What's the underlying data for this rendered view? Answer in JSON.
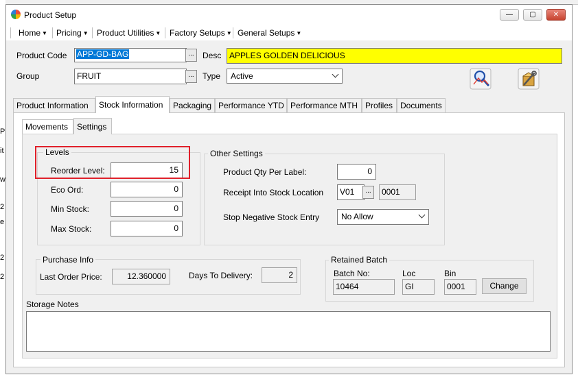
{
  "window": {
    "title": "Product Setup"
  },
  "menu": [
    {
      "label": "Home"
    },
    {
      "label": "Pricing"
    },
    {
      "label": "Product Utilities"
    },
    {
      "label": "Factory Setups"
    },
    {
      "label": "General Setups"
    }
  ],
  "header": {
    "product_code_label": "Product Code",
    "product_code_value": "APP-GD-BAG",
    "desc_label": "Desc",
    "desc_value": "APPLES GOLDEN DELICIOUS",
    "group_label": "Group",
    "group_value": "FRUIT",
    "type_label": "Type",
    "type_value": "Active",
    "ellipsis": "..."
  },
  "tabs": [
    "Product Information",
    "Stock Information",
    "Packaging",
    "Performance YTD",
    "Performance MTH",
    "Profiles",
    "Documents"
  ],
  "subtabs": [
    "Movements",
    "Settings"
  ],
  "levels": {
    "title": "Levels",
    "reorder_label": "Reorder Level:",
    "reorder_value": "15",
    "eco_label": "Eco Ord:",
    "eco_value": "0",
    "min_label": "Min Stock:",
    "min_value": "0",
    "max_label": "Max Stock:",
    "max_value": "0"
  },
  "other": {
    "title": "Other Settings",
    "qty_label": "Product Qty Per Label:",
    "qty_value": "0",
    "receipt_label": "Receipt Into Stock Location",
    "receipt_loc": "V01",
    "receipt_bin": "0001",
    "stopneg_label": "Stop Negative Stock Entry",
    "stopneg_value": "No Allow"
  },
  "purchase": {
    "title": "Purchase Info",
    "last_price_label": "Last Order Price:",
    "last_price_value": "12.360000",
    "days_label": "Days To Delivery:",
    "days_value": "2"
  },
  "batch": {
    "title": "Retained Batch",
    "batch_label": "Batch No:",
    "batch_value": "10464",
    "loc_label": "Loc",
    "loc_value": "GI",
    "bin_label": "Bin",
    "bin_value": "0001",
    "change_label": "Change"
  },
  "notes": {
    "label": "Storage Notes",
    "value": ""
  },
  "background_fragments": [
    "P",
    "it",
    "w",
    "2",
    "e",
    "2",
    "2"
  ],
  "colors": {
    "desc_highlight": "#ffff00",
    "selection": "#0078d7",
    "focus_outline": "#e0202a"
  },
  "icons": {
    "search_button": "magnifier-icon",
    "tools_button": "tools-icon"
  }
}
